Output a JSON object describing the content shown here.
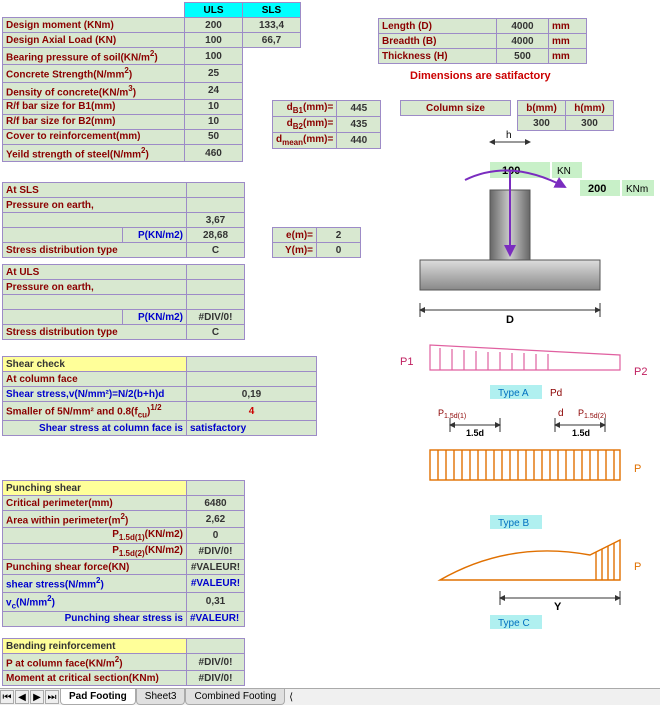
{
  "header": {
    "uls": "ULS",
    "sls": "SLS"
  },
  "left": {
    "design_moment": {
      "label": "Design moment (KNm)",
      "uls": "200",
      "sls": "133,4"
    },
    "design_axial": {
      "label": "Design Axial Load (KN)",
      "uls": "100",
      "sls": "66,7"
    },
    "bearing_pressure": {
      "label": "Bearing pressure of soil(KN/m",
      "uls": "100"
    },
    "concrete_strength": {
      "label": "Concrete Strength(N/mm",
      "uls": "25"
    },
    "density": {
      "label": "Density of concrete(KN/m",
      "uls": "24"
    },
    "rf_b1": {
      "label": "R/f bar size for B1(mm)",
      "uls": "10"
    },
    "rf_b2": {
      "label": "R/f bar size for B2(mm)",
      "uls": "10"
    },
    "cover": {
      "label": "Cover to reinforcement(mm)",
      "uls": "50"
    },
    "yield": {
      "label": "Yeild strength of steel(N/mm",
      "uls": "460"
    }
  },
  "right_top": {
    "length": {
      "label": "Length  (D)",
      "val": "4000",
      "unit": "mm"
    },
    "breadth": {
      "label": "Breadth (B)",
      "val": "4000",
      "unit": "mm"
    },
    "thickness": {
      "label": "Thickness (H)",
      "val": "500",
      "unit": "mm"
    },
    "note": "Dimensions are satifactory"
  },
  "db": {
    "db1": {
      "label": "d",
      "sub": "B1",
      "after": "(mm)=",
      "val": "445"
    },
    "db2": {
      "label": "d",
      "sub": "B2",
      "after": "(mm)=",
      "val": "435"
    },
    "dmean": {
      "label": "d",
      "sub": "mean",
      "after": "(mm)=",
      "val": "440"
    }
  },
  "col": {
    "column_size": "Column size",
    "b_hdr": "b(mm)",
    "h_hdr": "h(mm)",
    "b": "300",
    "h": "300"
  },
  "sls": {
    "heading": "At SLS",
    "pressure": "Pressure on earth,",
    "blank_val": "3,67",
    "p_label": "P(KN/m2)",
    "p_val": "28,68",
    "e_label": "e(m)=",
    "e_val": "2",
    "stress_label": "Stress distribution type",
    "stress_val": "C",
    "y_label": "Y(m)=",
    "y_val": "0"
  },
  "uls": {
    "heading": "At ULS",
    "pressure": "Pressure on earth,",
    "p_label": "P(KN/m2)",
    "p_val": "#DIV/0!",
    "stress_label": "Stress distribution type",
    "stress_val": "C"
  },
  "shear": {
    "heading": "Shear check",
    "at_face": "At column face",
    "stress_formula": "Shear stress,v(N/mm²)=N/2(b+h)d",
    "stress_val": "0,19",
    "smaller_label": "Smaller of 5N/mm² and 0.8(f",
    "smaller_sub": "cu",
    "smaller_after": ")",
    "smaller_sup": "1/2",
    "smaller_val": "4",
    "face_check": "Shear stress at column face is",
    "face_result": "satisfactory"
  },
  "punch": {
    "heading": "Punching shear",
    "crit_perim": {
      "label": "Critical perimeter(mm)",
      "val": "6480"
    },
    "area": {
      "label": "Area within perimeter(m",
      "val": "2,62"
    },
    "p1": {
      "label": "P",
      "sub": "1.5d(1)",
      "after": "(KN/m2)",
      "val": "0"
    },
    "p2": {
      "label": "P",
      "sub": "1.5d(2)",
      "after": "(KN/m2)",
      "val": "#DIV/0!"
    },
    "force": {
      "label": "Punching shear force(KN)",
      "val": "#VALEUR!"
    },
    "stress": {
      "label": "shear stress(N/mm",
      "val": "#VALEUR!"
    },
    "vc": {
      "label": "v",
      "sub": "c",
      "after": "(N/mm",
      "val": "0,31"
    },
    "result_label": "Punching shear stress  is",
    "result_val": "#VALEUR!"
  },
  "bending": {
    "heading": "Bending reinforcement",
    "p_face": {
      "label": "P at column face(KN/m",
      "val": "#DIV/0!"
    },
    "moment": {
      "label": "Moment at critical section(KNm)",
      "val": "#DIV/0!"
    }
  },
  "diag": {
    "h": "h",
    "load": "100",
    "load_u": "KN",
    "moment": "200",
    "moment_u": "KNm",
    "D": "D",
    "P1": "P1",
    "P2": "P2",
    "typeA": "Type A",
    "Pd": "Pd",
    "p15d1": "P",
    "p15d1s": "1.5d(1)",
    "p15d2": "P",
    "p15d2s": "1.5d(2)",
    "d": "d",
    "d15": "1.5d",
    "P": "P",
    "typeB": "Type B",
    "Y": "Y",
    "typeC": "Type C"
  },
  "tabs": {
    "t1": "Pad Footing",
    "t2": "Sheet3",
    "t3": "Combined Footing"
  }
}
